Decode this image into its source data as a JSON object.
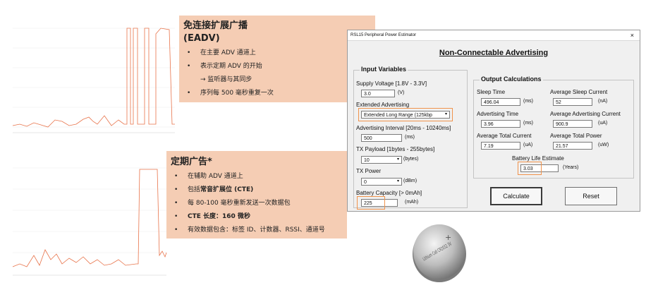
{
  "colors": {
    "callout_bg": "#f5cdb4",
    "highlight": "#f0934c",
    "trace": "#e8734a"
  },
  "callout_top": {
    "title1": "免连接扩展广播",
    "title2": "(EADV)",
    "b1": "在主要 ADV 通道上",
    "b2": "表示定期 ADV 的开始",
    "b2_sub": "→ 监听器与其同步",
    "b3": "序列每 500 毫秒重复一次"
  },
  "callout_bottom": {
    "title": "定期广告*",
    "b1": "在辅助 ADV 通道上",
    "b2_pre": "包括",
    "b2_bold": "常音扩展位 (CTE)",
    "b3": "每 80-100 毫秒重新发送一次数据包",
    "b4": "CTE 长度：160 微秒",
    "b5": "有效数据包含：标签 ID、计数器、RSSI、通道号"
  },
  "window": {
    "titlebar": "RSL15 Peripheral Power Estimator",
    "close": "×",
    "heading": "Non-Connectable Advertising",
    "input": {
      "legend": "Input Variables",
      "supply_label": "Supply Voltage [1.8V - 3.3V]",
      "supply_value": "3.0",
      "supply_unit": "(V)",
      "ext_label": "Extended Advertising",
      "ext_value": "Extended Long Range (125kbp",
      "interval_label": "Advertising Interval [20ms - 10240ms]",
      "interval_value": "500",
      "interval_unit": "(ms)",
      "payload_label": "TX Payload [1bytes - 255bytes]",
      "payload_value": "10",
      "payload_unit": "(bytes)",
      "power_label": "TX Power",
      "power_value": "0",
      "power_unit": "(dBm)",
      "capacity_label": "Battery Capacity [> 0mAh]",
      "capacity_value": "225",
      "capacity_unit": "(mAh)"
    },
    "output": {
      "legend": "Output Calculations",
      "sleep_time_label": "Sleep Time",
      "sleep_time_value": "496.04",
      "sleep_time_unit": "(ms)",
      "avg_sleep_label": "Average Sleep Current",
      "avg_sleep_value": "52",
      "avg_sleep_unit": "(nA)",
      "adv_time_label": "Advertising Time",
      "adv_time_value": "3.96",
      "adv_time_unit": "(ms)",
      "avg_adv_label": "Average Advertising Current",
      "avg_adv_value": "900.9",
      "avg_adv_unit": "(uA)",
      "avg_total_label": "Average Total Current",
      "avg_total_value": "7.19",
      "avg_total_unit": "(uA)",
      "avg_power_label": "Average Total Power",
      "avg_power_value": "21.57",
      "avg_power_unit": "(uW)",
      "life_label": "Battery Life Estimate",
      "life_value": "3.03",
      "life_unit": "(Years)"
    },
    "calculate": "Calculate",
    "reset": "Reset"
  },
  "battery": {
    "text": "Lithium Cell CR2032 3V"
  }
}
